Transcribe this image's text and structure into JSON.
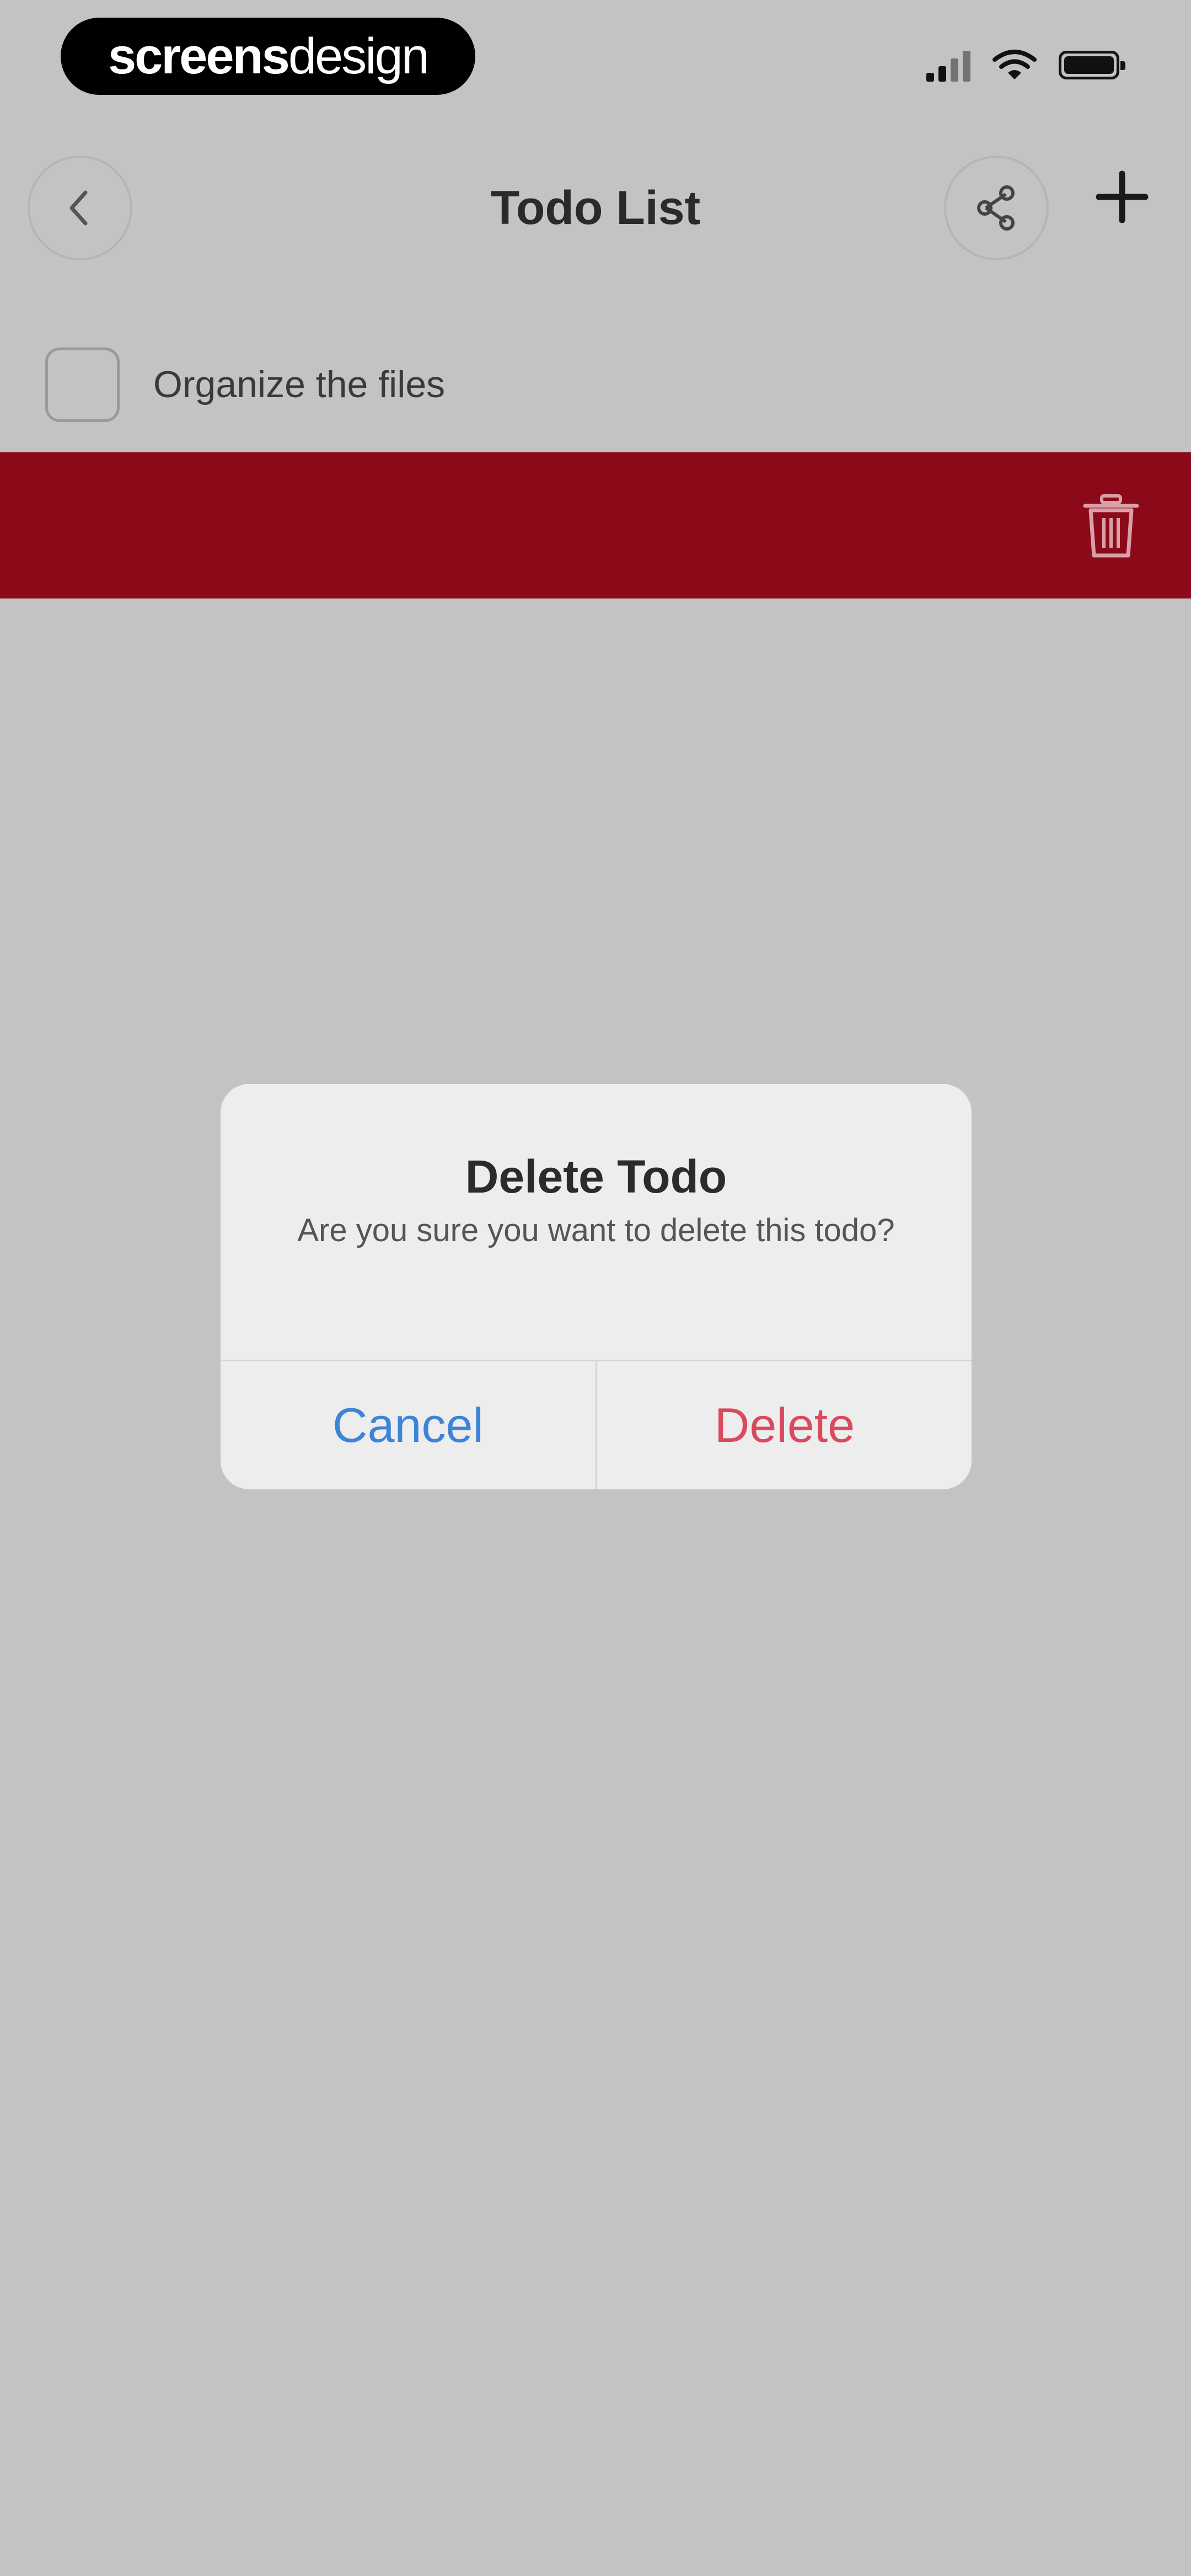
{
  "status_bar": {
    "brand_bold": "screens",
    "brand_light": "design",
    "icons": [
      "signal-icon",
      "wifi-icon",
      "battery-icon"
    ]
  },
  "nav": {
    "title": "Todo List",
    "back_icon": "chevron-left-icon",
    "share_icon": "share-icon",
    "add_icon": "plus-icon"
  },
  "todos": [
    {
      "label": "Organize the files",
      "checked": false
    }
  ],
  "swipe_action": {
    "icon": "trash-icon",
    "color": "#8b0a1a"
  },
  "alert": {
    "title": "Delete Todo",
    "message": "Are you sure you want to delete this todo?",
    "cancel_label": "Cancel",
    "delete_label": "Delete"
  },
  "colors": {
    "background": "#c3c3c5",
    "cancel": "#3d84d8",
    "delete": "#d94a5d",
    "swipe_red": "#8b0a1a"
  }
}
